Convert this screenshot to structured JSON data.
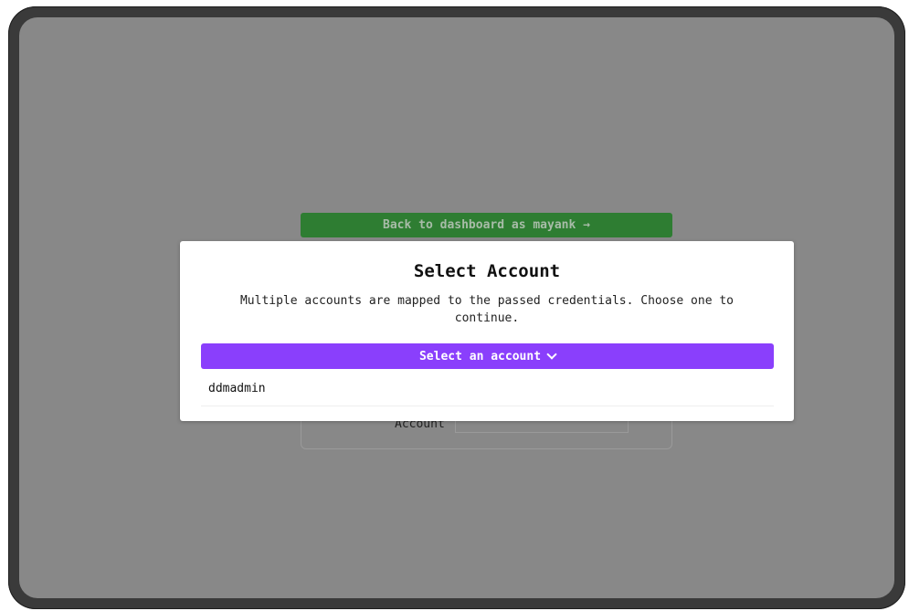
{
  "background": {
    "back_button_label": "Back to dashboard as mayank →",
    "account_label": "Account"
  },
  "modal": {
    "title": "Select Account",
    "description": "Multiple accounts are mapped to the passed credentials. Choose one to continue.",
    "select_button_label": "Select an account",
    "options": [
      {
        "label": "ddmadmin"
      }
    ]
  },
  "colors": {
    "overlay": "#888888",
    "accent": "#8a3ffc",
    "back_button": "#2e7d32"
  }
}
